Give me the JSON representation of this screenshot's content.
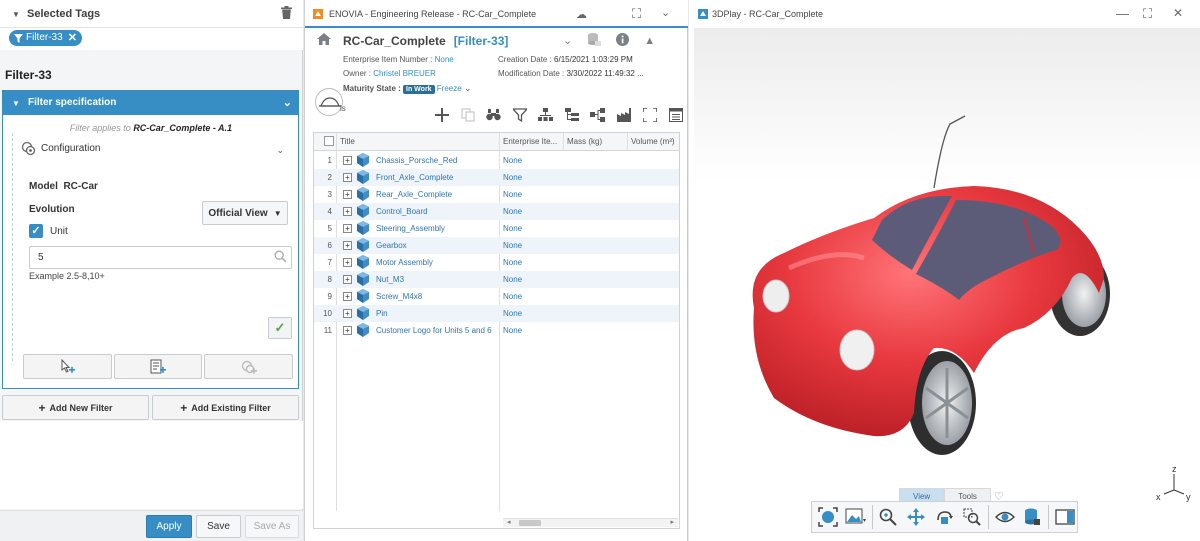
{
  "left": {
    "selected_tags_title": "Selected Tags",
    "tag_chip": "Filter-33",
    "filter_name": "Filter-33",
    "spec_header": "Filter specification",
    "applies_prefix": "Filter applies to ",
    "applies_target": "RC-Car_Complete - A.1",
    "configuration_label": "Configuration",
    "model_label": "Model",
    "model_value": "RC-Car",
    "evolution_label": "Evolution",
    "evolution_select": "Official View",
    "unit_label": "Unit",
    "unit_checked": true,
    "unit_value": "5",
    "example_text": "Example 2.5-8,10+",
    "add_new_filter": "Add New Filter",
    "add_existing_filter": "Add Existing Filter",
    "apply": "Apply",
    "save": "Save",
    "save_as": "Save As",
    "accent": "#368ec4"
  },
  "center": {
    "window_title": "ENOVIA - Engineering Release - RC-Car_Complete",
    "object_name": "RC-Car_Complete",
    "object_filter": "[Filter-33]",
    "enterprise_item_number_label": "Enterprise Item Number : ",
    "enterprise_item_number_value": "None",
    "owner_label": "Owner : ",
    "owner_value": "Christel BREUER",
    "maturity_label": "Maturity State : ",
    "maturity_badge": "In Work",
    "maturity_next": "Freeze",
    "creation_label": "Creation Date : ",
    "creation_value": "6/15/2021 1:03:29 PM",
    "modification_label": "Modification Date : ",
    "modification_value": "3/30/2022 11:49:32 ...",
    "avatar_text": "ls",
    "columns": [
      "Title",
      "Enterprise Ite...",
      "Mass (kg)",
      "Volume (m³)"
    ],
    "rows": [
      {
        "n": "1",
        "title": "Chassis_Porsche_Red",
        "eid": "None"
      },
      {
        "n": "2",
        "title": "Front_Axle_Complete",
        "eid": "None"
      },
      {
        "n": "3",
        "title": "Rear_Axle_Complete",
        "eid": "None"
      },
      {
        "n": "4",
        "title": "Control_Board",
        "eid": "None"
      },
      {
        "n": "5",
        "title": "Steering_Assembly",
        "eid": "None"
      },
      {
        "n": "6",
        "title": "Gearbox",
        "eid": "None"
      },
      {
        "n": "7",
        "title": "Motor Assembly",
        "eid": "None"
      },
      {
        "n": "8",
        "title": "Nut_M3",
        "eid": "None"
      },
      {
        "n": "9",
        "title": "Screw_M4x8",
        "eid": "None"
      },
      {
        "n": "10",
        "title": "Pin",
        "eid": "None"
      },
      {
        "n": "11",
        "title": "Customer Logo for Units 5 and 6",
        "eid": "None"
      }
    ]
  },
  "right": {
    "window_title": "3DPlay - RC-Car_Complete",
    "tab_view": "View",
    "tab_tools": "Tools",
    "axis_z": "z",
    "axis_x": "x",
    "axis_y": "y",
    "car_color": "#e8393f"
  }
}
